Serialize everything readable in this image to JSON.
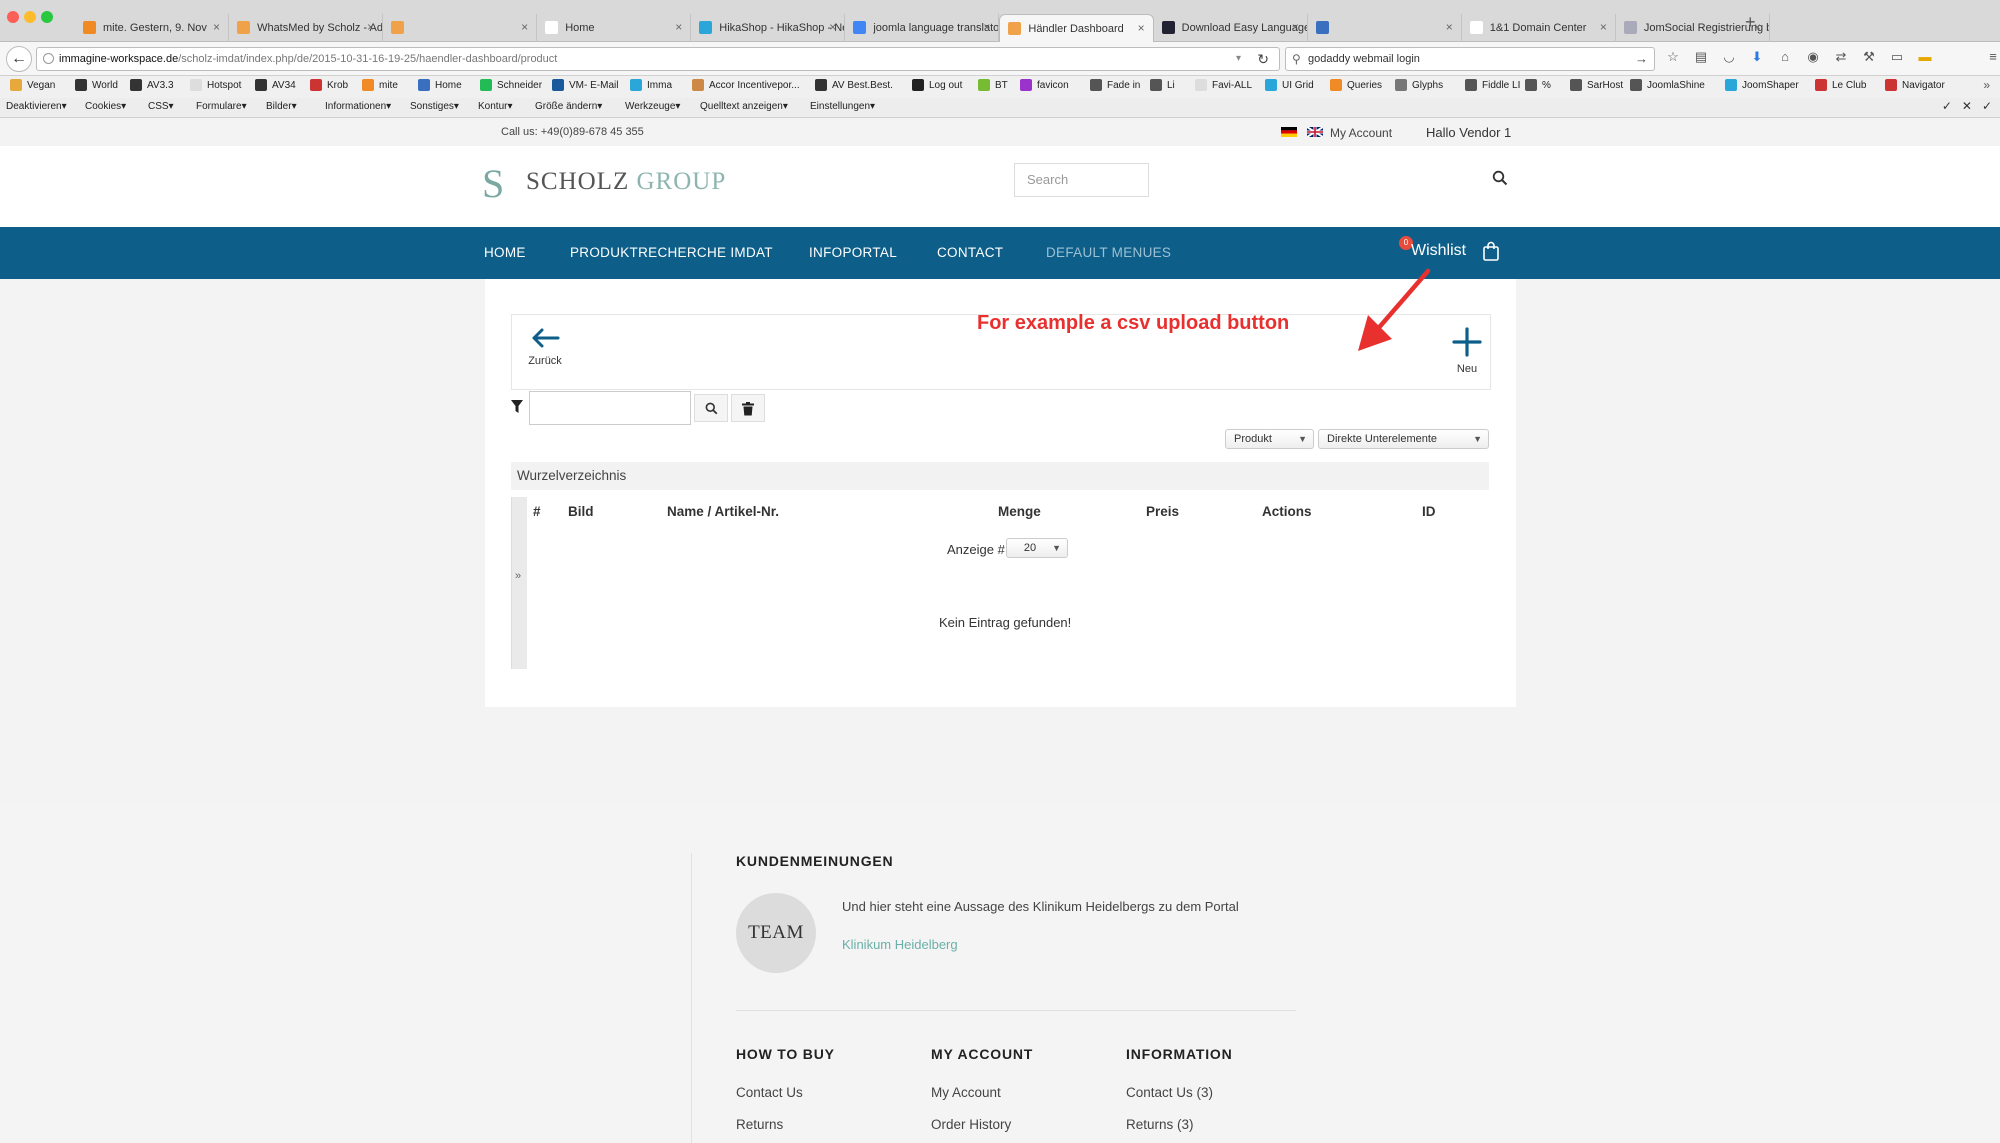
{
  "browser": {
    "tabs": [
      {
        "label": "mite. Gestern, 9. Nov",
        "color": "#f08a24"
      },
      {
        "label": "WhatsMed by Scholz - Adm...",
        "color": "#f0a24a"
      },
      {
        "label": "",
        "color": "#f0a24a"
      },
      {
        "label": "Home",
        "color": "#ffffff"
      },
      {
        "label": "HikaShop - HikaShop - Ne...",
        "color": "#2aa6d8"
      },
      {
        "label": "joomla language translator -...",
        "color": "#4285f4"
      },
      {
        "label": "Händler Dashboard",
        "color": "#f0a24a"
      },
      {
        "label": "Download Easy Language - ...",
        "color": "#223"
      },
      {
        "label": "",
        "color": "#3a6fc0"
      },
      {
        "label": "1&1 Domain Center",
        "color": "#ffffff"
      },
      {
        "label": "JomSocial Registrierung be...",
        "color": "#aab"
      }
    ],
    "url_domain": "immagine-workspace.de",
    "url_path": "/scholz-imdat/index.php/de/2015-10-31-16-19-25/haendler-dashboard/product",
    "search_value": "godaddy webmail login",
    "bookmarks": [
      {
        "label": "Vegan",
        "color": "#e8a93c"
      },
      {
        "label": "World",
        "color": "#333"
      },
      {
        "label": "AV3.3",
        "color": "#333"
      },
      {
        "label": "Hotspot",
        "color": "#ddd"
      },
      {
        "label": "AV34",
        "color": "#333"
      },
      {
        "label": "Krob",
        "color": "#c33"
      },
      {
        "label": "mite",
        "color": "#f08a24"
      },
      {
        "label": "Home",
        "color": "#3a6fc0"
      },
      {
        "label": "Schneider",
        "color": "#2b5"
      },
      {
        "label": "VM- E-Mail",
        "color": "#1a5a9c"
      },
      {
        "label": "Imma",
        "color": "#2aa6d8"
      },
      {
        "label": "Accor Incentivepor...",
        "color": "#c84"
      },
      {
        "label": "AV Best.Best.",
        "color": "#333"
      },
      {
        "label": "Log out",
        "color": "#222"
      },
      {
        "label": "BT",
        "color": "#7b3"
      },
      {
        "label": "favicon",
        "color": "#93c"
      },
      {
        "label": "Fade in",
        "color": "#555"
      },
      {
        "label": "Li",
        "color": "#555"
      },
      {
        "label": "Favi-ALL",
        "color": "#ddd"
      },
      {
        "label": "UI Grid",
        "color": "#2aa6d8"
      },
      {
        "label": "Queries",
        "color": "#f08a24"
      },
      {
        "label": "Glyphs",
        "color": "#777"
      },
      {
        "label": "Fiddle LI",
        "color": "#555"
      },
      {
        "label": "%",
        "color": "#555"
      },
      {
        "label": "SarHost",
        "color": "#555"
      },
      {
        "label": "JoomlaShine",
        "color": "#555"
      },
      {
        "label": "JoomShaper",
        "color": "#2aa6d8"
      },
      {
        "label": "Le Club",
        "color": "#c33"
      },
      {
        "label": "Navigator",
        "color": "#c33"
      }
    ],
    "webdev": [
      "Deaktivieren▾",
      "Cookies▾",
      "CSS▾",
      "Formulare▾",
      "Bilder▾",
      "Informationen▾",
      "Sonstiges▾",
      "Kontur▾",
      "Größe ändern▾",
      "Werkzeuge▾",
      "Quelltext anzeigen▾",
      "Einstellungen▾"
    ]
  },
  "site": {
    "callus": "Call us: +49(0)89-678 45 355",
    "my_account": "My Account",
    "hallo": "Hallo Vendor 1",
    "logo_initial": "S",
    "logo_a": "SCHOLZ",
    "logo_b": "GROUP",
    "search_placeholder": "Search",
    "nav": [
      "HOME",
      "PRODUKTRECHERCHE IMDAT",
      "INFOPORTAL",
      "CONTACT",
      "DEFAULT MENUES"
    ],
    "wishlist": "Wishlist",
    "wishlist_count": "0"
  },
  "dashboard": {
    "back_label": "Zurück",
    "new_label": "Neu",
    "annotation": "For example a csv upload button",
    "filter_value": "",
    "select_product": "Produkt",
    "select_children": "Direkte Unterelemente",
    "root": "Wurzelverzeichnis",
    "columns": [
      "#",
      "Bild",
      "Name / Artikel-Nr.",
      "Menge",
      "Preis",
      "Actions",
      "ID"
    ],
    "display_label": "Anzeige #",
    "display_value": "20",
    "empty": "Kein Eintrag gefunden!",
    "side_handle": "»"
  },
  "footer": {
    "reviews_heading": "KUNDENMEINUNGEN",
    "team_label": "TEAM",
    "quote": "Und hier steht eine Aussage des Klinikum Heidelbergs zu dem Portal",
    "quote_author": "Klinikum Heidelberg",
    "how_to_buy": {
      "title": "HOW TO BUY",
      "links": [
        "Contact Us",
        "Returns"
      ]
    },
    "my_account": {
      "title": "MY ACCOUNT",
      "links": [
        "My Account",
        "Order History"
      ]
    },
    "information": {
      "title": "INFORMATION",
      "links": [
        "Contact Us (3)",
        "Returns (3)"
      ]
    }
  }
}
